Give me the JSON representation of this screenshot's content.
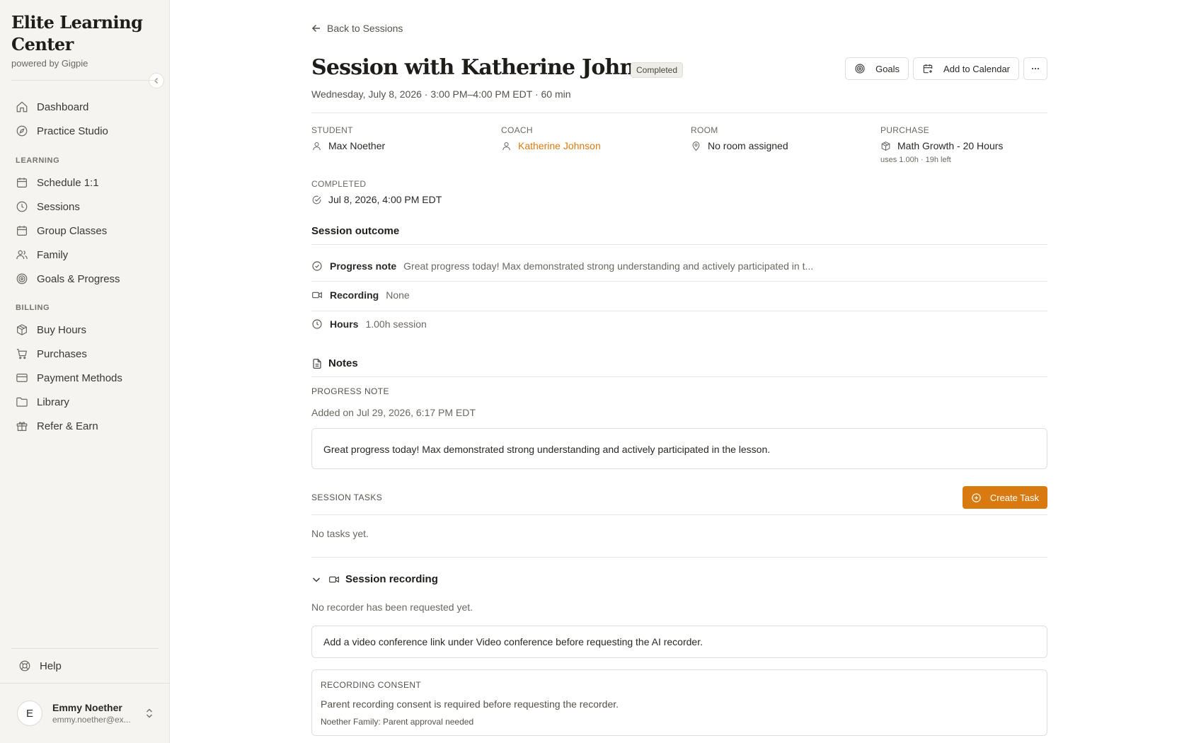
{
  "sidebar": {
    "brand_name": "Elite Learning Center",
    "brand_sub": "powered by Gigpie",
    "top_items": [
      {
        "label": "Dashboard",
        "icon": "home-icon"
      },
      {
        "label": "Practice Studio",
        "icon": "compass-icon"
      }
    ],
    "learning_heading": "LEARNING",
    "learning_items": [
      {
        "label": "Schedule 1:1",
        "icon": "calendar-icon"
      },
      {
        "label": "Sessions",
        "icon": "clock-icon"
      },
      {
        "label": "Group Classes",
        "icon": "calendar-icon"
      },
      {
        "label": "Family",
        "icon": "users-icon"
      },
      {
        "label": "Goals & Progress",
        "icon": "target-icon"
      }
    ],
    "billing_heading": "BILLING",
    "billing_items": [
      {
        "label": "Buy Hours",
        "icon": "package-icon"
      },
      {
        "label": "Purchases",
        "icon": "cart-icon"
      },
      {
        "label": "Payment Methods",
        "icon": "credit-card-icon"
      },
      {
        "label": "Library",
        "icon": "folder-icon"
      },
      {
        "label": "Refer & Earn",
        "icon": "gift-icon"
      }
    ],
    "help_label": "Help",
    "user": {
      "initial": "E",
      "name": "Emmy Noether",
      "email": "emmy.noether@ex..."
    }
  },
  "header": {
    "back_label": "Back to Sessions",
    "title": "Session with Katherine Johnson",
    "status_badge": "Completed",
    "subtitle": "Wednesday, July 8, 2026 · 3:00 PM–4:00 PM EDT · 60 min",
    "goals_label": "Goals",
    "calendar_label": "Add to Calendar"
  },
  "details": {
    "student_label": "STUDENT",
    "student_value": "Max Noether",
    "coach_label": "COACH",
    "coach_value": "Katherine Johnson",
    "room_label": "ROOM",
    "room_value": "No room assigned",
    "purchase_label": "PURCHASE",
    "purchase_value": "Math Growth - 20 Hours",
    "purchase_sub": "uses 1.00h · 19h left",
    "completed_label": "COMPLETED",
    "completed_value": "Jul 8, 2026, 4:00 PM EDT"
  },
  "outcome": {
    "title": "Session outcome",
    "progress_label": "Progress note",
    "progress_value": "Great progress today! Max demonstrated strong understanding and actively participated in t...",
    "recording_label": "Recording",
    "recording_value": "None",
    "hours_label": "Hours",
    "hours_value": "1.00h session"
  },
  "notes": {
    "title": "Notes",
    "progress_heading": "PROGRESS NOTE",
    "added_on": "Added on Jul 29, 2026, 6:17 PM EDT",
    "note_text": "Great progress today! Max demonstrated strong understanding and actively participated in the lesson."
  },
  "tasks": {
    "heading": "SESSION TASKS",
    "create_label": "Create Task",
    "empty": "No tasks yet."
  },
  "recording": {
    "title": "Session recording",
    "status": "No recorder has been requested yet.",
    "hint": "Add a video conference link under Video conference before requesting the AI recorder.",
    "consent_heading": "RECORDING CONSENT",
    "consent_text": "Parent recording consent is required before requesting the recorder.",
    "consent_family": "Noether Family: Parent approval needed"
  },
  "colors": {
    "accent": "#d97a10",
    "sidebar_bg": "#f5f4f1"
  }
}
